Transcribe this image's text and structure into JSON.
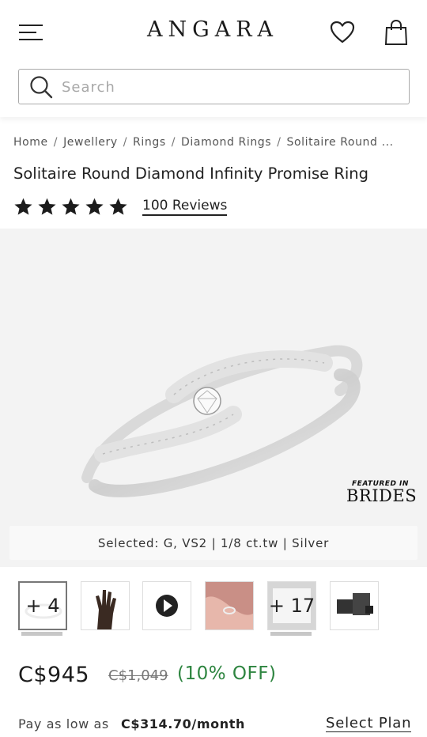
{
  "header": {
    "logo": "ANGARA",
    "icons": [
      "menu-icon",
      "heart-icon",
      "shopping-bag-icon"
    ]
  },
  "search": {
    "placeholder": "Search",
    "value": ""
  },
  "breadcrumb": {
    "items": [
      "Home",
      "Jewellery",
      "Rings",
      "Diamond Rings",
      "Solitaire Round ..."
    ],
    "separator": "/"
  },
  "product": {
    "title": "Solitaire Round Diamond Infinity Promise Ring",
    "rating_stars": 5,
    "reviews_label": "100 Reviews",
    "selected_label": "Selected: G, VS2 | 1/8 ct.tw | Silver"
  },
  "badge": {
    "small_text": "FEATURED IN",
    "brand_text": "BRIDES"
  },
  "thumbnails": [
    {
      "type": "image",
      "name": "ring-front",
      "overlay": "+ 4",
      "active": true
    },
    {
      "type": "image",
      "name": "hand-model"
    },
    {
      "type": "video",
      "name": "play-icon"
    },
    {
      "type": "image",
      "name": "ring-on-finger"
    },
    {
      "type": "image",
      "name": "ring-box",
      "overlay": "+ 17"
    },
    {
      "type": "image",
      "name": "packaging"
    }
  ],
  "pricing": {
    "current": "C$945",
    "original": "C$1,049",
    "discount": "(10% OFF)",
    "emi_prefix": "Pay as low as",
    "emi_amount": "C$314.70/month",
    "select_plan": "Select Plan"
  },
  "colors": {
    "discount_green": "#2e8540",
    "text_dark": "#1c1c1c",
    "gallery_bg": "#f3f3f3"
  }
}
